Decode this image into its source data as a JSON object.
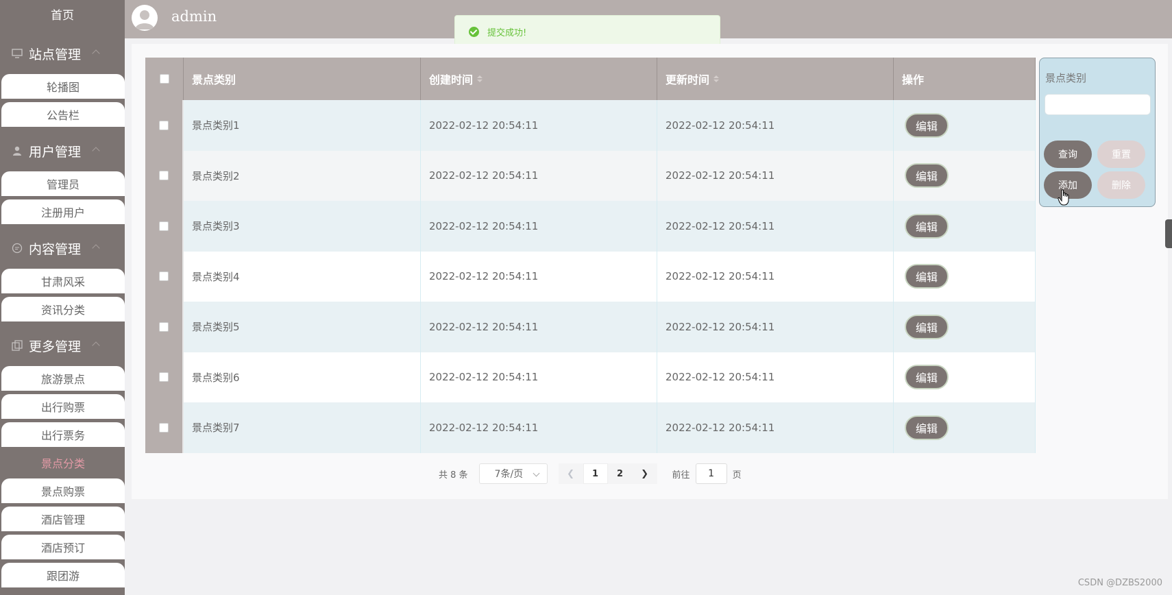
{
  "sidebar": {
    "home": "首页",
    "groups": [
      {
        "title": "站点管理",
        "icon": "monitor-icon",
        "items": [
          "轮播图",
          "公告栏"
        ]
      },
      {
        "title": "用户管理",
        "icon": "user-icon",
        "items": [
          "管理员",
          "注册用户"
        ]
      },
      {
        "title": "内容管理",
        "icon": "chat-icon",
        "items": [
          "甘肃风采",
          "资讯分类"
        ]
      },
      {
        "title": "更多管理",
        "icon": "copy-icon",
        "items": [
          "旅游景点",
          "出行购票",
          "出行票务",
          "景点分类",
          "景点购票",
          "酒店管理",
          "酒店预订",
          "跟团游"
        ]
      }
    ],
    "active_item": "景点分类"
  },
  "header": {
    "user": "admin"
  },
  "toast": {
    "message": "提交成功!",
    "status_color": "#67c23a"
  },
  "table": {
    "columns": [
      "景点类别",
      "创建时间",
      "更新时间",
      "操作"
    ],
    "rows": [
      {
        "category": "景点类别1",
        "created": "2022-02-12 20:54:11",
        "updated": "2022-02-12 20:54:11",
        "action": "编辑"
      },
      {
        "category": "景点类别2",
        "created": "2022-02-12 20:54:11",
        "updated": "2022-02-12 20:54:11",
        "action": "编辑"
      },
      {
        "category": "景点类别3",
        "created": "2022-02-12 20:54:11",
        "updated": "2022-02-12 20:54:11",
        "action": "编辑"
      },
      {
        "category": "景点类别4",
        "created": "2022-02-12 20:54:11",
        "updated": "2022-02-12 20:54:11",
        "action": "编辑"
      },
      {
        "category": "景点类别5",
        "created": "2022-02-12 20:54:11",
        "updated": "2022-02-12 20:54:11",
        "action": "编辑"
      },
      {
        "category": "景点类别6",
        "created": "2022-02-12 20:54:11",
        "updated": "2022-02-12 20:54:11",
        "action": "编辑"
      },
      {
        "category": "景点类别7",
        "created": "2022-02-12 20:54:11",
        "updated": "2022-02-12 20:54:11",
        "action": "编辑"
      }
    ]
  },
  "search": {
    "label": "景点类别",
    "input_value": "",
    "query": "查询",
    "reset": "重置",
    "add": "添加",
    "delete": "删除"
  },
  "pagination": {
    "total": "共 8 条",
    "page_size": "7条/页",
    "pages": [
      "1",
      "2"
    ],
    "goto_prefix": "前往",
    "goto_value": "1",
    "goto_suffix": "页"
  },
  "watermark": "CSDN @DZBS2000",
  "colors": {
    "sidebar": "#7c7472",
    "header": "#b6aeac",
    "active_item": "#e39aa6",
    "row_alt": "#e8f1f4",
    "search_box": "#c9e1eb"
  }
}
